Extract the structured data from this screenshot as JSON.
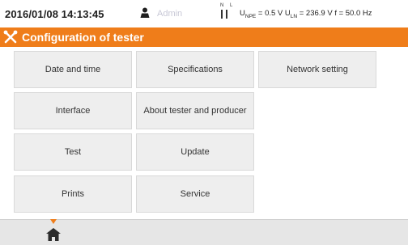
{
  "status": {
    "datetime": "2016/01/08 14:13:45",
    "user_icon": "user-icon",
    "user": "Admin",
    "plug_icon": "plug-icon",
    "plug_label": "N L",
    "measure": {
      "u_npe_label": "U",
      "u_npe_sub": "NPE",
      "u_npe_val": " = 0.5 V ",
      "u_ln_label": "U",
      "u_ln_sub": "LN",
      "u_ln_val": " = 236.9 V ",
      "f_val": "f = 50.0 Hz"
    }
  },
  "header": {
    "icon": "wrench-screwdriver-icon",
    "title": "Configuration of tester"
  },
  "menu": [
    "Date and time",
    "Specifications",
    "Network setting",
    "Interface",
    "About tester and producer",
    "Test",
    "Update",
    "Prints",
    "Service"
  ],
  "footer": {
    "home_icon": "home-icon"
  },
  "colors": {
    "accent": "#ef7d1a",
    "button_bg": "#eeeeee",
    "footer_bg": "#e6e6e6"
  }
}
